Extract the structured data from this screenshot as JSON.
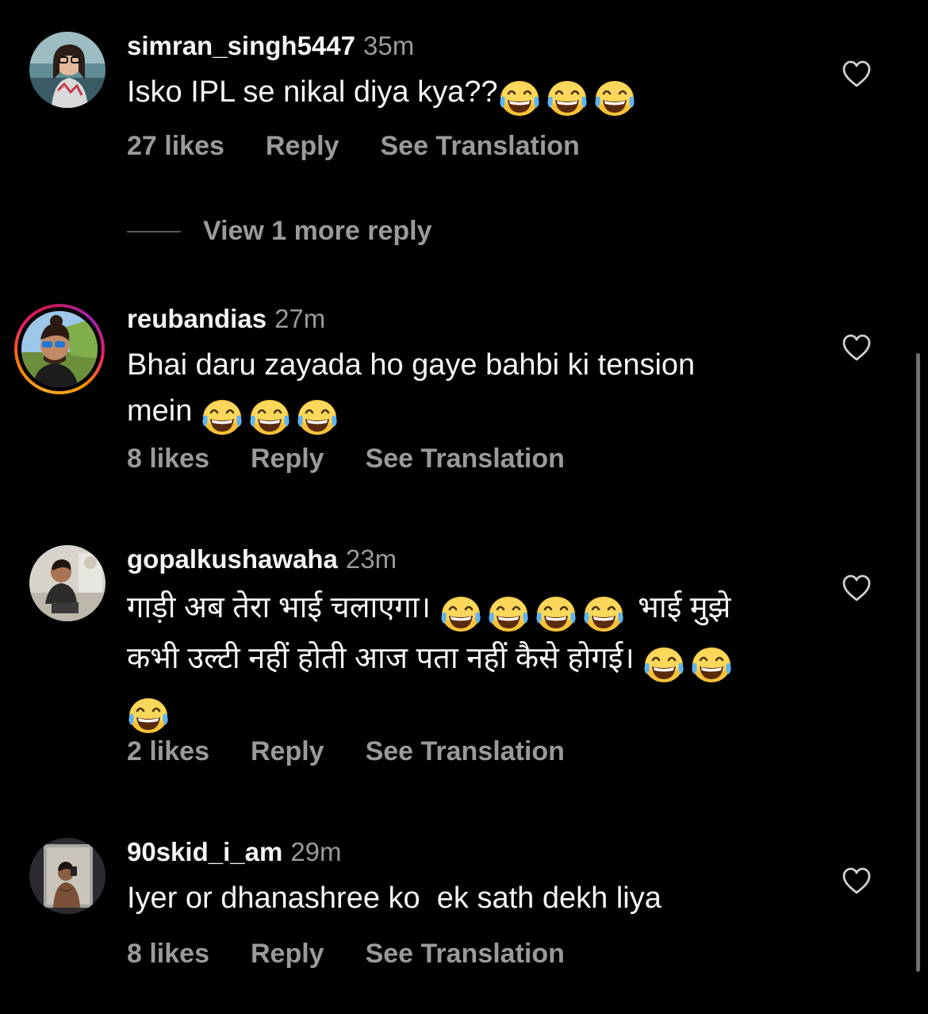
{
  "comments": [
    {
      "username": "simran_singh5447",
      "time": "35m",
      "text": "Isko IPL se nikal diya kya??",
      "likes": "27 likes",
      "reply": "Reply",
      "translate": "See Translation"
    },
    {
      "username": "reubandias",
      "time": "27m",
      "text_line1": "Bhai daru zayada ho gaye bahbi ki tension",
      "text_line2": "mein",
      "likes": "8 likes",
      "reply": "Reply",
      "translate": "See Translation"
    },
    {
      "username": "gopalkushawaha",
      "time": "23m",
      "text_line1a": "गाड़ी अब तेरा भाई चलाएगा।",
      "text_line1b": "भाई मुझे",
      "text_line2": "कभी उल्टी नहीं होती आज पता नहीं कैसे होगई।",
      "likes": "2 likes",
      "reply": "Reply",
      "translate": "See Translation"
    },
    {
      "username": "90skid_i_am",
      "time": "29m",
      "text": "Iyer or dhanashree ko  ek sath dekh liya",
      "likes": "8 likes",
      "reply": "Reply",
      "translate": "See Translation"
    }
  ],
  "view_more": "View 1 more reply",
  "icons": {
    "like": "heart-icon",
    "emoji": "face-with-tears-of-joy-emoji"
  },
  "colors": {
    "background": "#000000",
    "primary_text": "#f5f5f5",
    "secondary_text": "#9a9a9a",
    "story_ring": [
      "#f9a825",
      "#e91e63",
      "#9c27b0"
    ]
  }
}
